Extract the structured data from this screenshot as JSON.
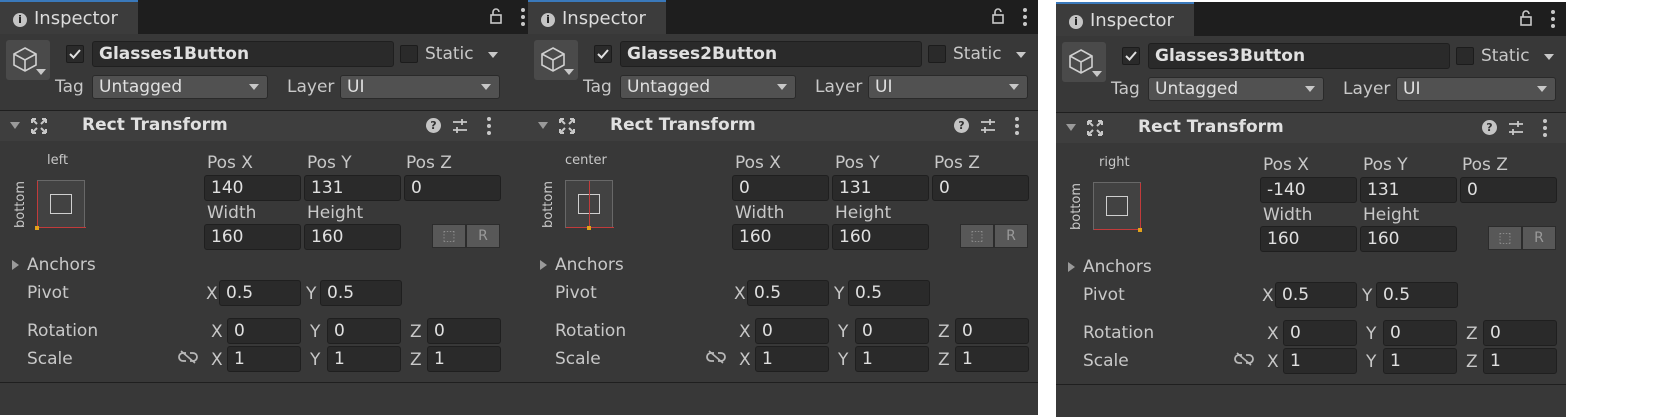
{
  "panels": [
    {
      "tab": "Inspector",
      "name": "Glasses1Button",
      "static_label": "Static",
      "tag_label": "Tag",
      "tag_value": "Untagged",
      "layer_label": "Layer",
      "layer_value": "UI",
      "component": "Rect Transform",
      "anchor_h": "left",
      "anchor_v": "bottom",
      "pos_x_label": "Pos X",
      "pos_y_label": "Pos Y",
      "pos_z_label": "Pos Z",
      "pos_x": "140",
      "pos_y": "131",
      "pos_z": "0",
      "width_label": "Width",
      "height_label": "Height",
      "width": "160",
      "height": "160",
      "anchors_label": "Anchors",
      "pivot_label": "Pivot",
      "pivot_x": "0.5",
      "pivot_y": "0.5",
      "rotation_label": "Rotation",
      "rot_x": "0",
      "rot_y": "0",
      "rot_z": "0",
      "scale_label": "Scale",
      "scale_x": "1",
      "scale_y": "1",
      "scale_z": "1",
      "axis_x": "X",
      "axis_y": "Y",
      "axis_z": "Z",
      "raw_btn": "R"
    },
    {
      "tab": "Inspector",
      "name": "Glasses2Button",
      "static_label": "Static",
      "tag_label": "Tag",
      "tag_value": "Untagged",
      "layer_label": "Layer",
      "layer_value": "UI",
      "component": "Rect Transform",
      "anchor_h": "center",
      "anchor_v": "bottom",
      "pos_x_label": "Pos X",
      "pos_y_label": "Pos Y",
      "pos_z_label": "Pos Z",
      "pos_x": "0",
      "pos_y": "131",
      "pos_z": "0",
      "width_label": "Width",
      "height_label": "Height",
      "width": "160",
      "height": "160",
      "anchors_label": "Anchors",
      "pivot_label": "Pivot",
      "pivot_x": "0.5",
      "pivot_y": "0.5",
      "rotation_label": "Rotation",
      "rot_x": "0",
      "rot_y": "0",
      "rot_z": "0",
      "scale_label": "Scale",
      "scale_x": "1",
      "scale_y": "1",
      "scale_z": "1",
      "axis_x": "X",
      "axis_y": "Y",
      "axis_z": "Z",
      "raw_btn": "R"
    },
    {
      "tab": "Inspector",
      "name": "Glasses3Button",
      "static_label": "Static",
      "tag_label": "Tag",
      "tag_value": "Untagged",
      "layer_label": "Layer",
      "layer_value": "UI",
      "component": "Rect Transform",
      "anchor_h": "right",
      "anchor_v": "bottom",
      "pos_x_label": "Pos X",
      "pos_y_label": "Pos Y",
      "pos_z_label": "Pos Z",
      "pos_x": "-140",
      "pos_y": "131",
      "pos_z": "0",
      "width_label": "Width",
      "height_label": "Height",
      "width": "160",
      "height": "160",
      "anchors_label": "Anchors",
      "pivot_label": "Pivot",
      "pivot_x": "0.5",
      "pivot_y": "0.5",
      "rotation_label": "Rotation",
      "rot_x": "0",
      "rot_y": "0",
      "rot_z": "0",
      "scale_label": "Scale",
      "scale_x": "1",
      "scale_y": "1",
      "scale_z": "1",
      "axis_x": "X",
      "axis_y": "Y",
      "axis_z": "Z",
      "raw_btn": "R"
    }
  ],
  "icons": {
    "tab": "info-icon",
    "lock": "lock-icon",
    "menu": "kebab-menu-icon",
    "object": "gameobject-cube-icon",
    "component": "rect-transform-icon",
    "help": "help-icon",
    "presets": "presets-icon",
    "link": "constrain-proportions-icon"
  },
  "colors": {
    "accent": "#3a79bb",
    "anchor_line": "#c23b3b",
    "pivot": "#e3a21a",
    "panel_bg": "#383838"
  }
}
